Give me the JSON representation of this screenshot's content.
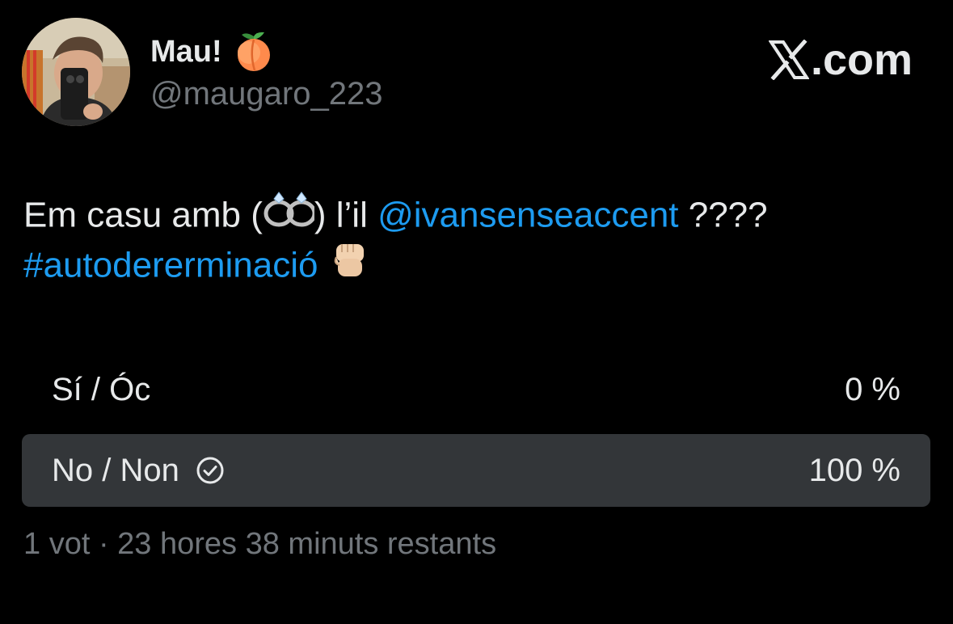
{
  "author": {
    "display_name": "Mau!",
    "name_emoji": "peach-emoji",
    "handle": "@maugaro_223"
  },
  "site": {
    "logo": "x-logo-icon",
    "label": ".com"
  },
  "tweet": {
    "text_part1": "Em casu amb (",
    "ring_emoji": "ring-emoji",
    "text_part2": ") l’il ",
    "mention": "@ivansenseaccent",
    "text_part3": " ????",
    "hashtag": "#autodererminació",
    "fist_emoji": "raised-fist-emoji"
  },
  "poll": {
    "options": [
      {
        "label": "Sí / Óc",
        "percent": "0 %",
        "value": 0,
        "selected": false
      },
      {
        "label": "No / Non",
        "percent": "100 %",
        "value": 100,
        "selected": true
      }
    ],
    "meta": "1 vot · 23 hores 38 minuts restants"
  },
  "colors": {
    "background": "#000000",
    "text": "#e7e9ea",
    "secondary": "#71767b",
    "link": "#1d9bf0",
    "winner_bar": "#333639"
  }
}
